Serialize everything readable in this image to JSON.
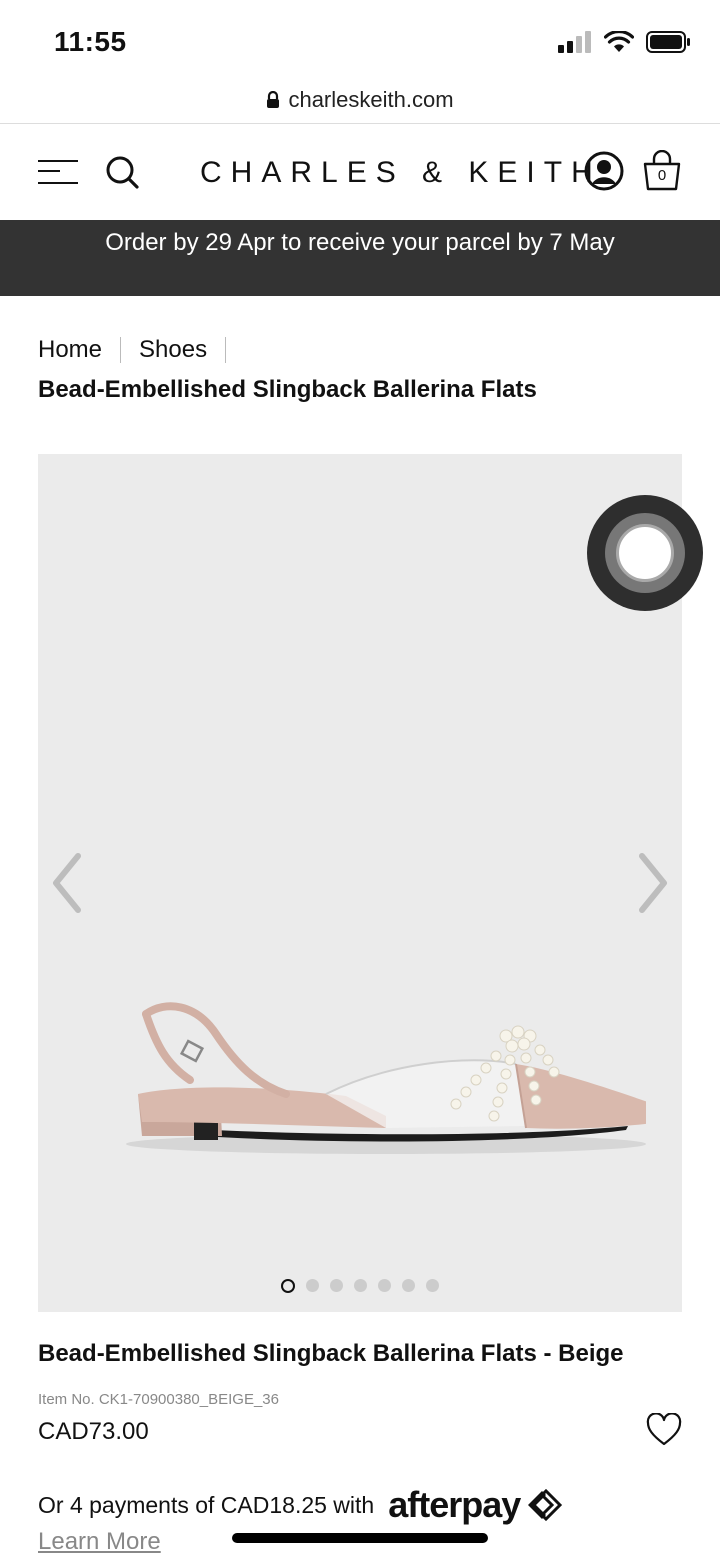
{
  "status_bar": {
    "time": "11:55",
    "signal_icon": "cellular-signal-icon",
    "wifi_icon": "wifi-icon",
    "battery_icon": "battery-icon"
  },
  "browser": {
    "lock_icon": "lock-icon",
    "url": "charleskeith.com"
  },
  "header": {
    "menu_icon": "hamburger-menu-icon",
    "search_icon": "search-icon",
    "brand": "CHARLES & KEITH",
    "account_icon": "user-account-icon",
    "bag_icon": "shopping-bag-icon",
    "bag_count": "0"
  },
  "banner": {
    "text": "Order by 29 Apr to receive your parcel by 7 May"
  },
  "breadcrumb": {
    "items": [
      "Home",
      "Shoes"
    ],
    "current": "Bead-Embellished Slingback Ballerina Flats"
  },
  "gallery": {
    "prev_icon": "chevron-left-icon",
    "next_icon": "chevron-right-icon",
    "image_subject": "beige pointed-toe slingback ballerina flat with pearl strands",
    "total_images": 7,
    "active_index": 0
  },
  "product": {
    "name": "Bead-Embellished Slingback Ballerina Flats - Beige",
    "item_no": "Item No. CK1-70900380_BEIGE_36",
    "price": "CAD73.00",
    "wishlist_icon": "heart-icon"
  },
  "payment": {
    "installments_text": "Or 4 payments of CAD18.25 with",
    "provider": "afterpay",
    "learn_more": "Learn More"
  },
  "colors": {
    "banner_bg": "#333333",
    "gallery_bg": "#ebebeb",
    "shoe_beige": "#d9b9ad"
  }
}
